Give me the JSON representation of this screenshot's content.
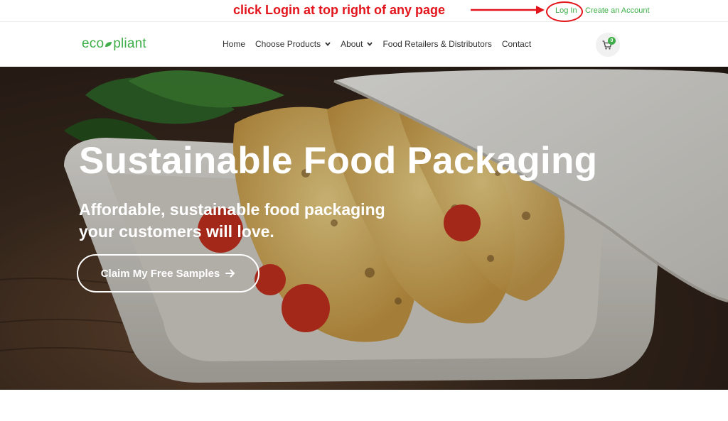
{
  "annotation": {
    "text": "click Login at top right of any page",
    "color": "#e3141b"
  },
  "topbar": {
    "login_label": "Log In",
    "create_account_label": "Create an Account"
  },
  "brand": {
    "logo_left": "eco",
    "logo_right": "pliant",
    "accent_color": "#3fae49"
  },
  "nav": {
    "items": [
      {
        "label": "Home",
        "has_dropdown": false
      },
      {
        "label": "Choose Products",
        "has_dropdown": true
      },
      {
        "label": "About",
        "has_dropdown": true
      },
      {
        "label": "Food Retailers & Distributors",
        "has_dropdown": false
      },
      {
        "label": "Contact",
        "has_dropdown": false
      }
    ]
  },
  "cart": {
    "icon": "cart-icon",
    "count": "0"
  },
  "hero": {
    "title": "Sustainable Food Packaging",
    "subtitle_line1": "Affordable, sustainable food packaging",
    "subtitle_line2": "your customers will love.",
    "cta_label": "Claim My Free Samples",
    "cta_icon": "arrow-right-icon"
  }
}
